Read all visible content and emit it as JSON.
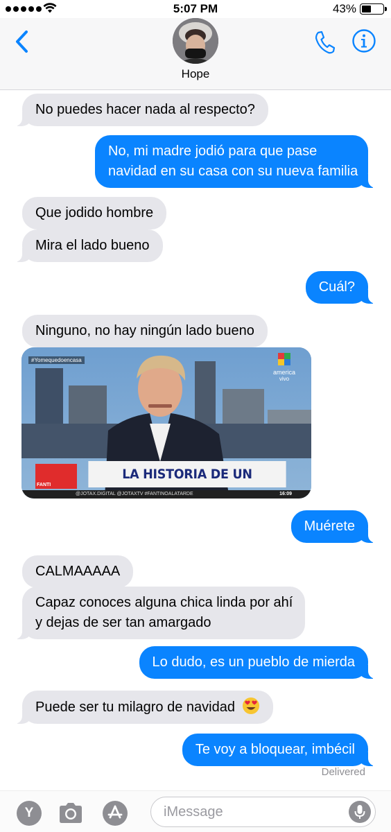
{
  "status_bar": {
    "time": "5:07 PM",
    "battery_text": "43%",
    "battery_level": 0.43,
    "signal_dots": 5
  },
  "header": {
    "contact_name": "Hope",
    "icons": [
      "chevron-left-icon",
      "phone-icon",
      "info-icon"
    ],
    "accent_color": "#0a84ff"
  },
  "messages": [
    {
      "dir": "in",
      "text": "No puedes hacer nada al respecto?"
    },
    {
      "dir": "out",
      "lines": [
        "No, mi madre jodió para que pase",
        "navidad en su casa con su nueva familia"
      ]
    },
    {
      "dir": "in",
      "text": "Que jodido hombre"
    },
    {
      "dir": "in",
      "text": "Mira el lado bueno"
    },
    {
      "dir": "out",
      "text": "Cuál?"
    },
    {
      "dir": "in",
      "text": "Ninguno, no hay ningún lado bueno"
    },
    {
      "dir": "in",
      "type": "image",
      "image": {
        "hashtag": "#Yomequedoencasa",
        "channel_name": "america",
        "channel_live": "vivo",
        "banner": "LA HISTORIA DE UN PERDEDOR",
        "banner_tag": "FANTI",
        "ticker": "@JOTAX.DIGITAL   @JOTAXTV   #FANTINOALATARDE",
        "ticker_time": "16:09"
      }
    },
    {
      "dir": "out",
      "text": "Muérete"
    },
    {
      "dir": "in",
      "text": "CALMAAAAA"
    },
    {
      "dir": "in",
      "lines": [
        "Capaz conoces alguna chica linda por ahí",
        "y dejas de ser tan amargado"
      ]
    },
    {
      "dir": "out",
      "text": "Lo dudo, es un pueblo de mierda"
    },
    {
      "dir": "in",
      "text": "Puede ser tu milagro de navidad",
      "emoji": "heart-eyes"
    },
    {
      "dir": "out",
      "text": "Te voy a bloquear, imbécil"
    }
  ],
  "delivered_label": "Delivered",
  "input_bar": {
    "placeholder": "iMessage",
    "apps_label": "Y",
    "icons": [
      "apps-icon",
      "camera-icon",
      "appstore-icon",
      "mic-icon"
    ]
  },
  "colors": {
    "incoming_bubble": "#e6e6eb",
    "outgoing_bubble": "#0a84ff",
    "meta_text": "#8e8e93"
  }
}
